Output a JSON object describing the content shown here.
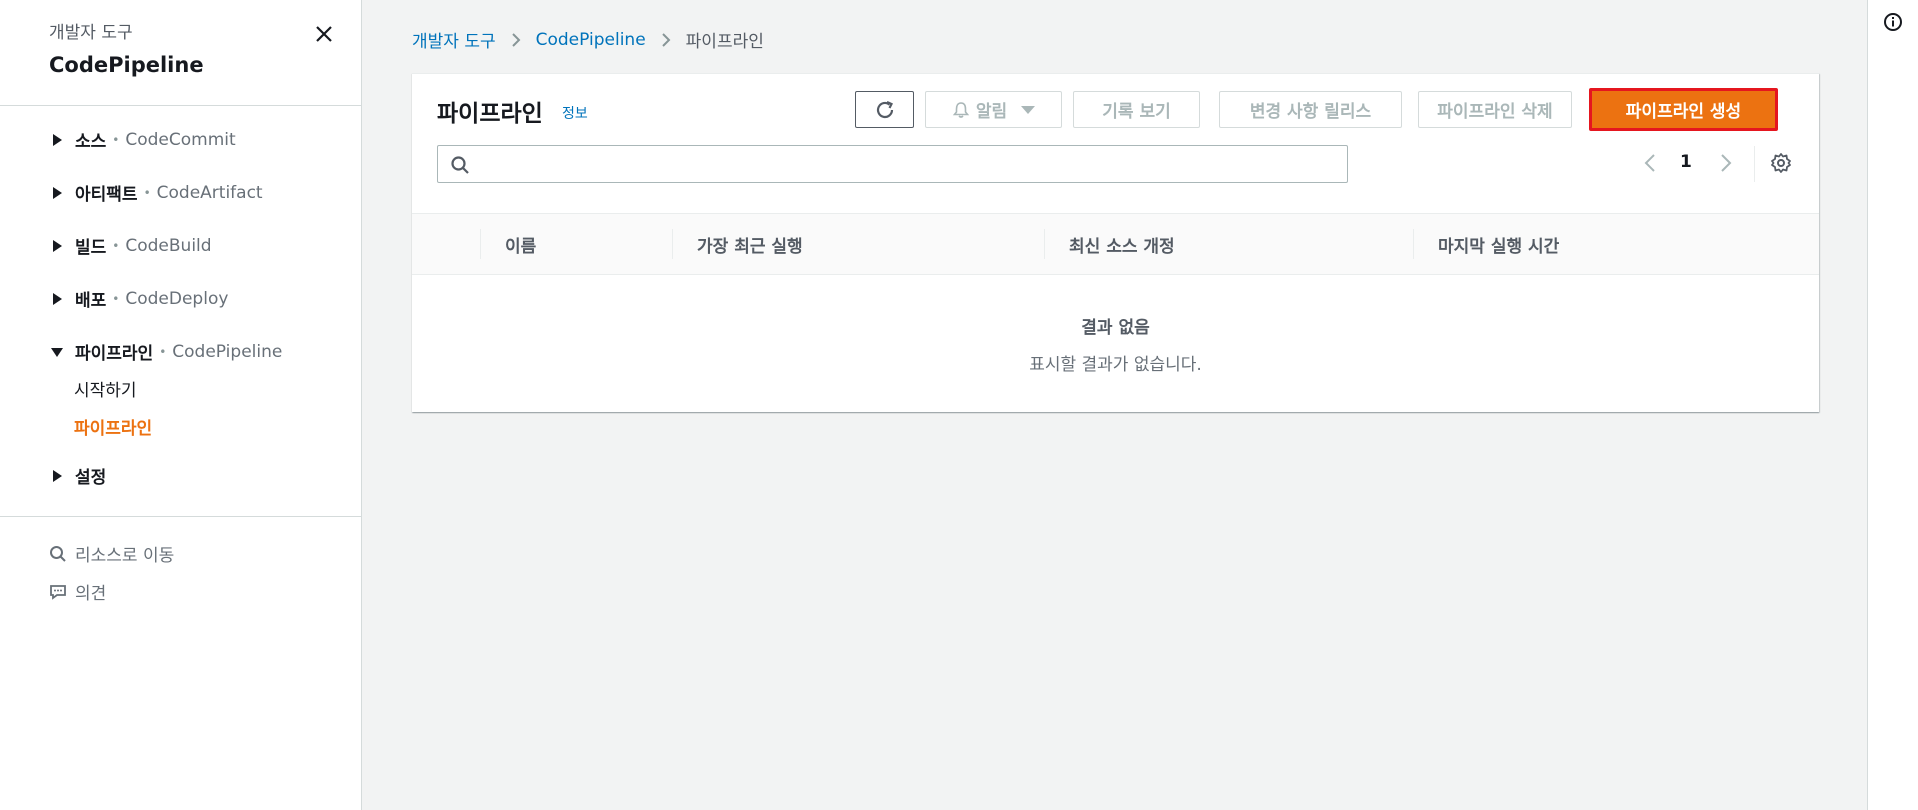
{
  "sidebar": {
    "subtitle": "개발자 도구",
    "title": "CodePipeline",
    "sections": [
      {
        "label": "소스",
        "service": "CodeCommit"
      },
      {
        "label": "아티팩트",
        "service": "CodeArtifact"
      },
      {
        "label": "빌드",
        "service": "CodeBuild"
      },
      {
        "label": "배포",
        "service": "CodeDeploy"
      },
      {
        "label": "파이프라인",
        "service": "CodePipeline"
      },
      {
        "label": "설정",
        "service": ""
      }
    ],
    "pipeline_sub": [
      "시작하기",
      "파이프라인"
    ],
    "utilities": {
      "goto_resource": "리소스로 이동",
      "feedback": "의견"
    },
    "separator": "•"
  },
  "breadcrumb": [
    "개발자 도구",
    "CodePipeline",
    "파이프라인"
  ],
  "panel": {
    "title": "파이프라인",
    "info": "정보",
    "buttons": {
      "notify": "알림",
      "history": "기록 보기",
      "release": "변경 사항 릴리스",
      "delete": "파이프라인 삭제",
      "create": "파이프라인 생성"
    },
    "search": {
      "placeholder": "",
      "value": ""
    },
    "pagination": {
      "current_page": "1"
    },
    "columns": [
      "이름",
      "가장 최근 실행",
      "최신 소스 개정",
      "마지막 실행 시간"
    ],
    "empty": {
      "title": "결과 없음",
      "description": "표시할 결과가 없습니다."
    }
  },
  "colors": {
    "accent": "#ec7211",
    "link": "#0073bb",
    "highlight_border": "#e5161f"
  },
  "icons": [
    "close-icon",
    "caret-right-icon",
    "caret-down-icon",
    "search-icon",
    "message-icon",
    "chevron-right-icon",
    "refresh-icon",
    "bell-icon",
    "dropdown-icon",
    "chevron-left-icon",
    "settings-icon",
    "info-icon"
  ]
}
